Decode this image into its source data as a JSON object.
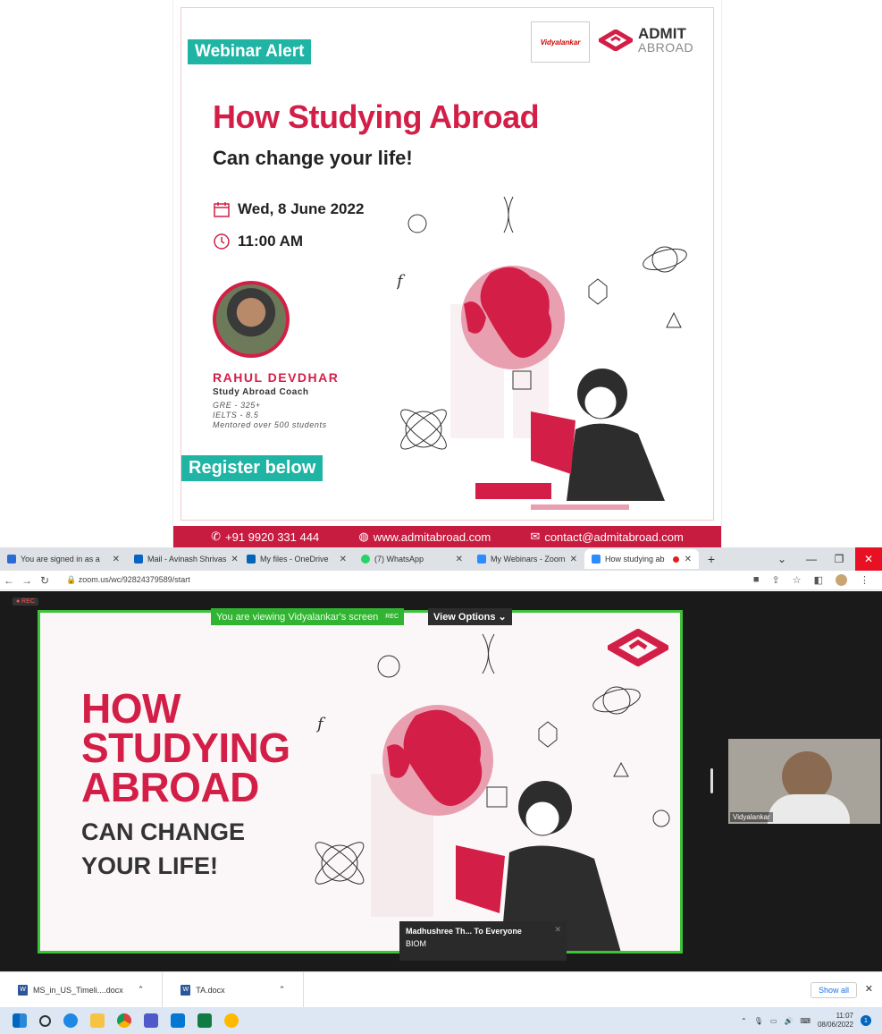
{
  "poster": {
    "alert_badge": "Webinar Alert",
    "title": "How Studying Abroad",
    "subtitle": "Can change your life!",
    "date": "Wed, 8 June 2022",
    "time": "11:00 AM",
    "speaker_name": "RAHUL DEVDHAR",
    "speaker_role": "Study Abroad Coach",
    "speaker_lines": [
      "GRE - 325+",
      "IELTS - 8.5",
      "Mentored over 500 students"
    ],
    "register": "Register below",
    "phone": "+91 9920 331 444",
    "website": "www.admitabroad.com",
    "email": "contact@admitabroad.com",
    "logo_left": "Vidyalankar",
    "logo_right_1": "ADMIT",
    "logo_right_2": "ABROAD",
    "colors": {
      "accent": "#d31f47",
      "badge": "#1fb4a4",
      "footer": "#c81b40"
    }
  },
  "browser": {
    "tabs": [
      {
        "label": "You are signed in as a",
        "favicon": "#2a6bd8"
      },
      {
        "label": "Mail - Avinash Shrivas",
        "favicon": "#0a64c2"
      },
      {
        "label": "My files - OneDrive",
        "favicon": "#0364b8"
      },
      {
        "label": "(7) WhatsApp",
        "favicon": "#25d366"
      },
      {
        "label": "My Webinars - Zoom",
        "favicon": "#2d8cff"
      },
      {
        "label": "How studying ab",
        "favicon": "#2d8cff",
        "active": true
      }
    ],
    "new_tab": "+",
    "url": "zoom.us/wc/92824379589/start"
  },
  "zoom": {
    "rec_label": "● REC",
    "share_banner": "You are viewing Vidyalankar's screen",
    "share_rec": "REC",
    "view_options": "View Options",
    "slide_title_lines": [
      "HOW",
      "STUDYING",
      "ABROAD"
    ],
    "slide_sub_lines": [
      "CAN CHANGE",
      "YOUR LIFE!"
    ],
    "chat_sender": "Madhushree Th... To Everyone",
    "chat_message": "BIOM",
    "video_name": "Vidyalankar"
  },
  "downloads": {
    "items": [
      "MS_in_US_Timeli....docx",
      "TA.docx"
    ],
    "show_all": "Show all"
  },
  "taskbar": {
    "time": "11:07",
    "date": "08/06/2022",
    "notif": "1"
  }
}
